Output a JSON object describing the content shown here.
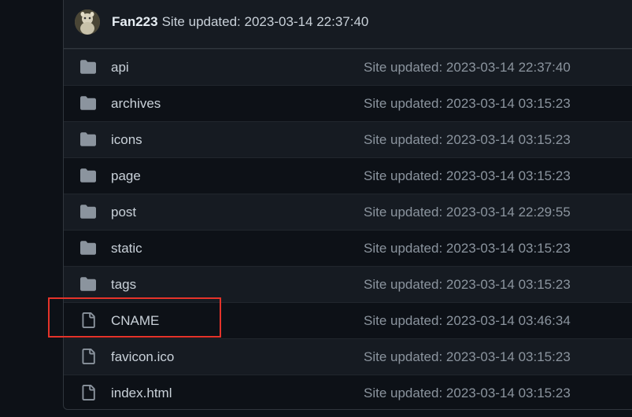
{
  "commit": {
    "author": "Fan223",
    "message": "Site updated: 2023-03-14 22:37:40"
  },
  "files": [
    {
      "name": "api",
      "type": "folder",
      "message": "Site updated: 2023-03-14 22:37:40"
    },
    {
      "name": "archives",
      "type": "folder",
      "message": "Site updated: 2023-03-14 03:15:23"
    },
    {
      "name": "icons",
      "type": "folder",
      "message": "Site updated: 2023-03-14 03:15:23"
    },
    {
      "name": "page",
      "type": "folder",
      "message": "Site updated: 2023-03-14 03:15:23"
    },
    {
      "name": "post",
      "type": "folder",
      "message": "Site updated: 2023-03-14 22:29:55"
    },
    {
      "name": "static",
      "type": "folder",
      "message": "Site updated: 2023-03-14 03:15:23"
    },
    {
      "name": "tags",
      "type": "folder",
      "message": "Site updated: 2023-03-14 03:15:23"
    },
    {
      "name": "CNAME",
      "type": "file",
      "message": "Site updated: 2023-03-14 03:46:34"
    },
    {
      "name": "favicon.ico",
      "type": "file",
      "message": "Site updated: 2023-03-14 03:15:23"
    },
    {
      "name": "index.html",
      "type": "file",
      "message": "Site updated: 2023-03-14 03:15:23"
    }
  ],
  "icons": {
    "folder": "folder-icon",
    "file": "file-icon"
  },
  "colors": {
    "background": "#0d1117",
    "row_alt": "#161b22",
    "border": "#30363d",
    "text": "#c9d1d9",
    "muted": "#8b949e",
    "icon": "#8b949e",
    "highlight": "#e5332a"
  },
  "highlighted_file": "CNAME"
}
